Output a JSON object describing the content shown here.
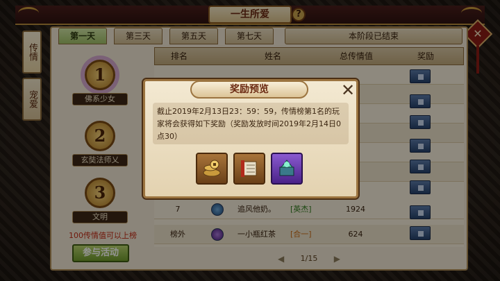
{
  "header": {
    "title": "一生所爱",
    "help_label": "?",
    "close_label": "✕"
  },
  "side_tabs": [
    {
      "label": "传情"
    },
    {
      "label": "宠爱"
    }
  ],
  "day_tabs": [
    {
      "label": "第一天"
    },
    {
      "label": "第三天"
    },
    {
      "label": "第五天"
    },
    {
      "label": "第七天"
    }
  ],
  "stage_status": "本阶段已结束",
  "top_ranks": [
    {
      "medal": "1",
      "name": "佛系少女"
    },
    {
      "medal": "2",
      "name": "玄奘法师乂"
    },
    {
      "medal": "3",
      "name": "文明"
    }
  ],
  "min_note": "100传情值可以上榜",
  "join_button": "参与活动",
  "table": {
    "headers": {
      "rank": "排名",
      "name": "姓名",
      "score": "总传情值",
      "reward": "奖励"
    },
    "rows": [
      {
        "rank": "7",
        "name": "追风他奶。",
        "tag": "[英杰]",
        "score": "1924"
      },
      {
        "rank": "榜外",
        "name": "一小瓶红茶",
        "tag": "[合一]",
        "score": "624"
      }
    ]
  },
  "pager": "1/15",
  "modal": {
    "title": "奖励预览",
    "close_label": "✕",
    "description": "截止2019年2月13日23：59：59，传情榜第1名的玩家将会获得如下奖励（奖励发放时间2019年2月14日0点30）",
    "rewards": [
      {
        "icon": "coins-icon"
      },
      {
        "icon": "scroll-icon"
      },
      {
        "icon": "chest-gem-icon"
      }
    ]
  }
}
